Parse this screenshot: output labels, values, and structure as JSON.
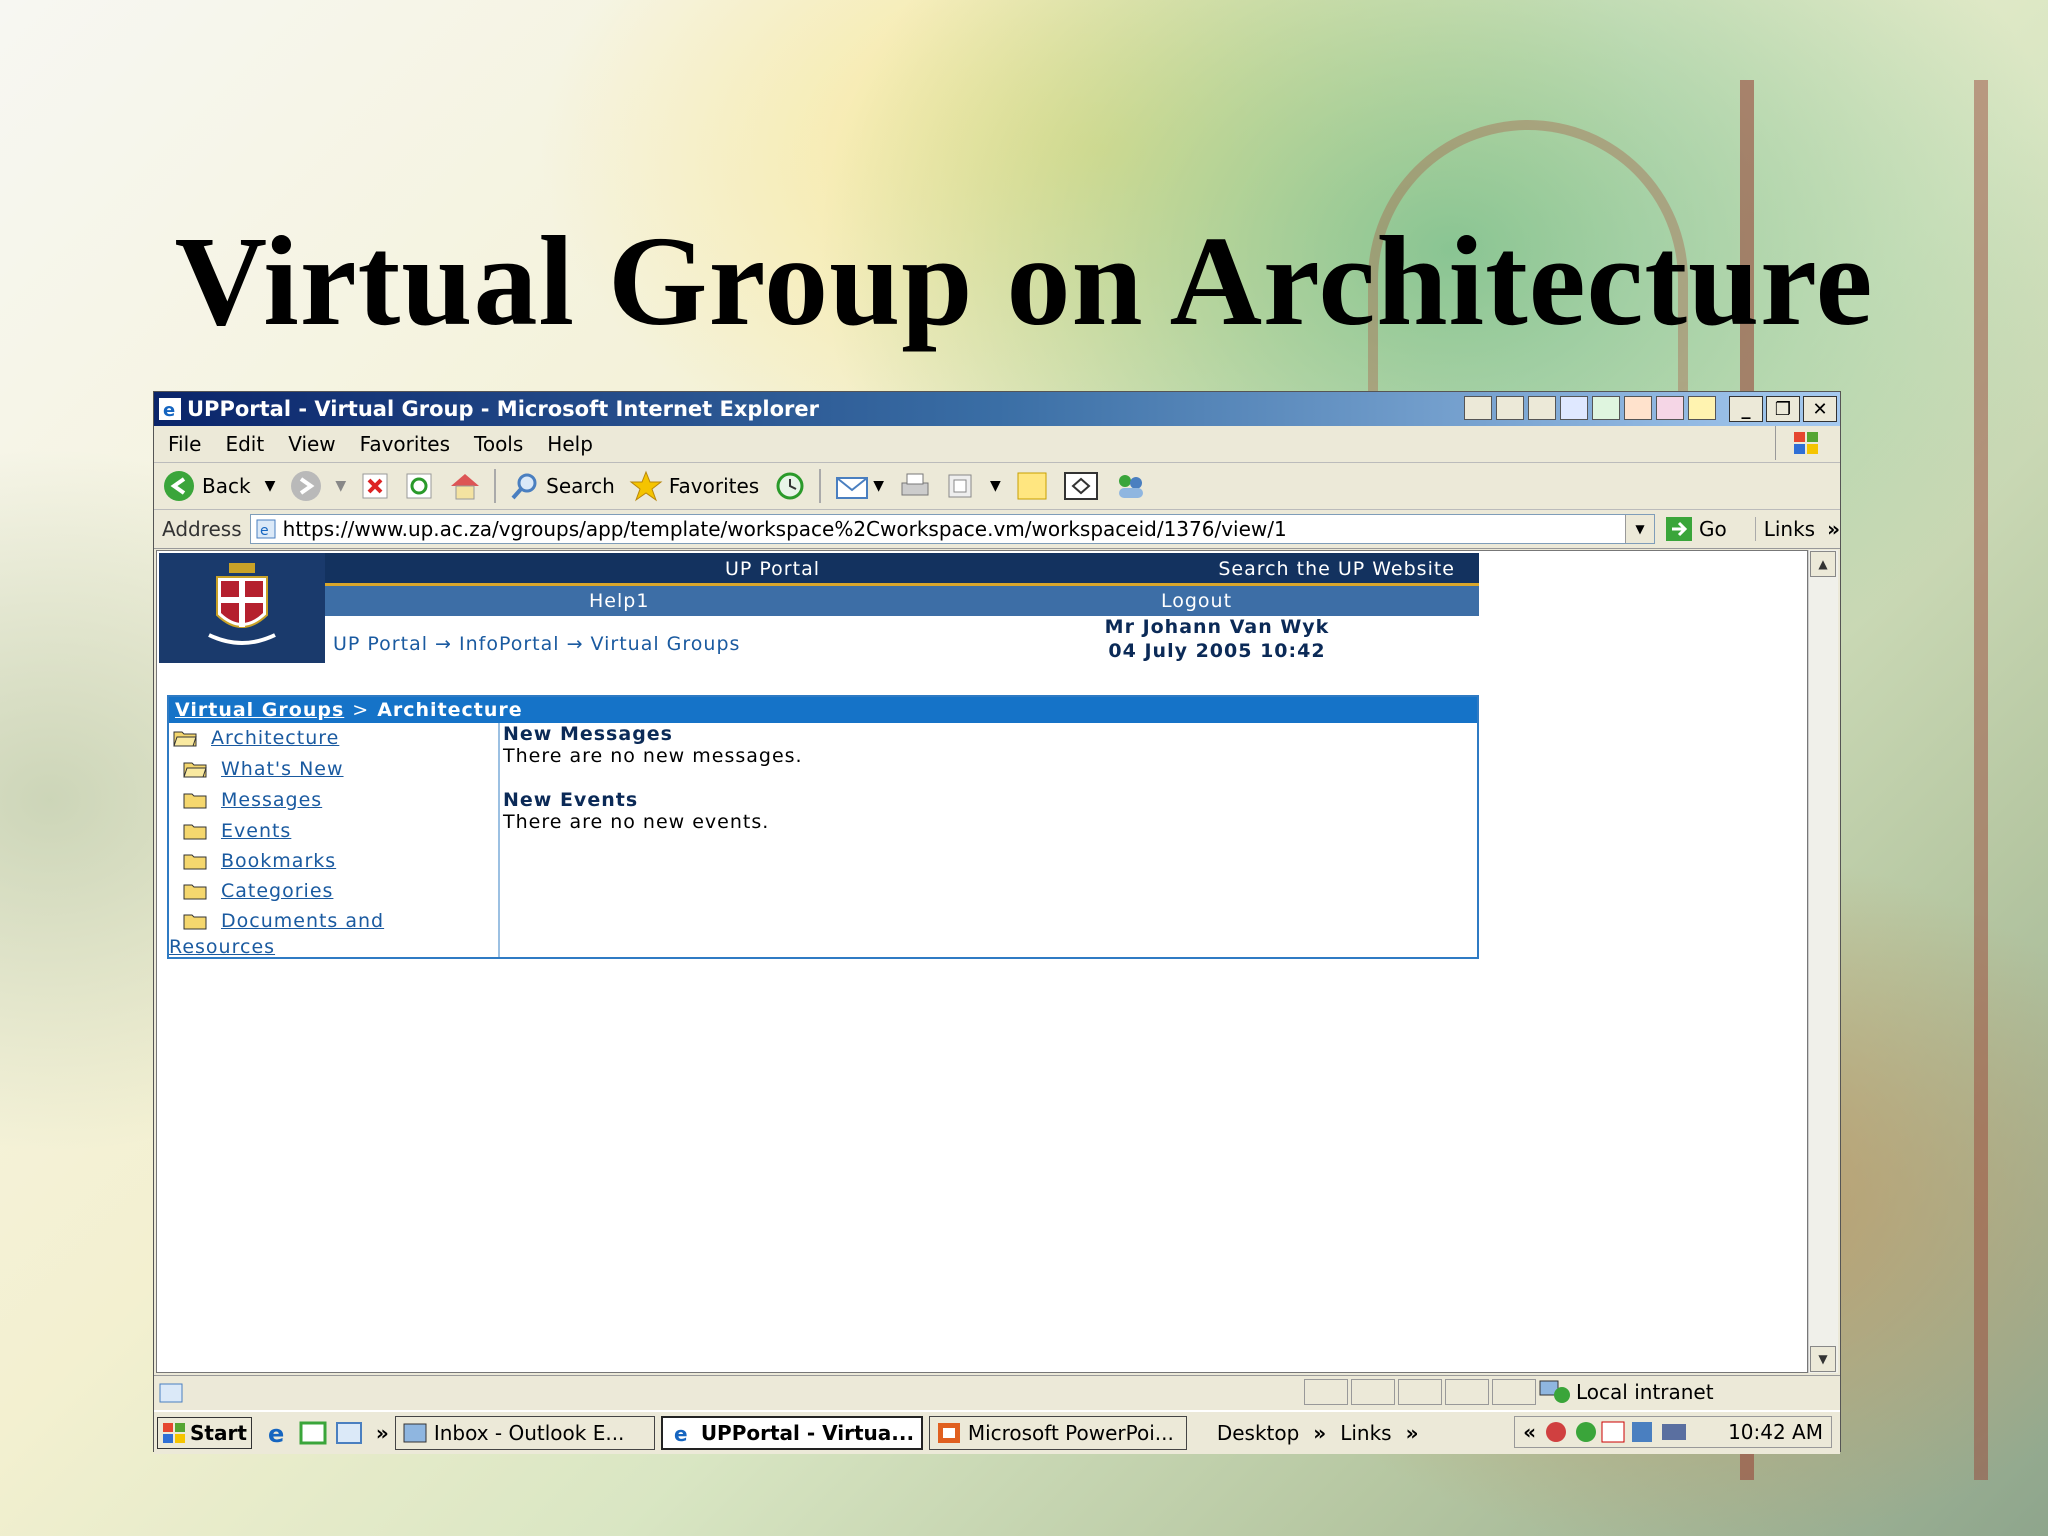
{
  "slide": {
    "title": "Virtual Group on Architecture"
  },
  "window": {
    "title": "UPPortal - Virtual Group - Microsoft Internet Explorer",
    "controls": [
      "_",
      "❐",
      "✕"
    ]
  },
  "menu": [
    "File",
    "Edit",
    "View",
    "Favorites",
    "Tools",
    "Help"
  ],
  "toolbar": {
    "back": "Back",
    "search": "Search",
    "favorites": "Favorites"
  },
  "address": {
    "label": "Address",
    "url": "https://www.up.ac.za/vgroups/app/template/workspace%2Cworkspace.vm/workspaceid/1376/view/1",
    "go": "Go",
    "links": "Links"
  },
  "portal": {
    "top_left": "UP Portal",
    "top_right": "Search the UP Website",
    "help": "Help1",
    "logout": "Logout",
    "breadcrumb": "UP Portal → InfoPortal → Virtual Groups",
    "user": "Mr Johann Van Wyk",
    "datetime": "04 July 2005 10:42"
  },
  "panel": {
    "crumb_link": "Virtual Groups",
    "crumb_sep": ">",
    "crumb_current": "Architecture",
    "nav": [
      "Architecture",
      "What's New",
      "Messages",
      "Events",
      "Bookmarks",
      "Categories",
      "Documents and",
      "Resources"
    ],
    "messages_heading": "New Messages",
    "messages_text": "There are no new messages.",
    "events_heading": "New Events",
    "events_text": "There are no new events."
  },
  "status": {
    "zone": "Local intranet"
  },
  "taskbar": {
    "start": "Start",
    "tasks": [
      "Inbox - Outlook E...",
      "UPPortal - Virtua...",
      "Microsoft PowerPoi..."
    ],
    "desktop": "Desktop",
    "links": "Links",
    "clock": "10:42 AM"
  }
}
